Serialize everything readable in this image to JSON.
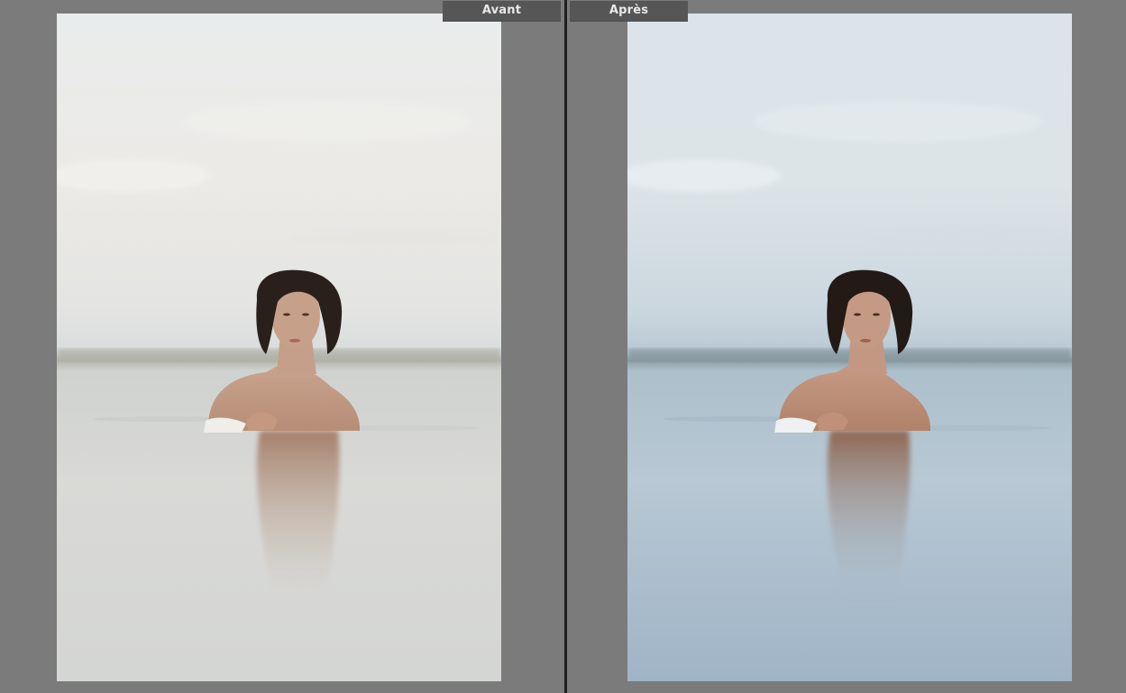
{
  "view": {
    "before_label": "Avant",
    "after_label": "Après"
  },
  "colors": {
    "background": "#7b7b7b",
    "divider": "#1f1f1f",
    "label_bg": "#565656",
    "label_text": "#e9e9e9"
  }
}
